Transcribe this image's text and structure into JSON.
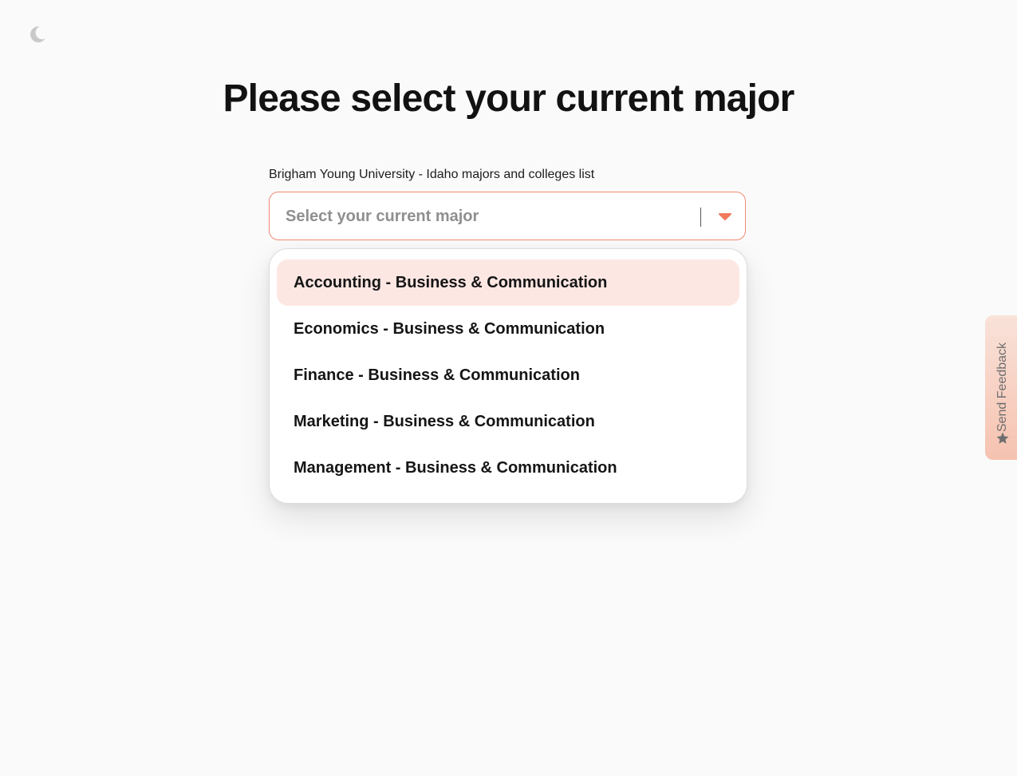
{
  "header": {
    "theme_toggle_icon": "moon-icon",
    "title": "Please select your current major"
  },
  "form": {
    "label": "Brigham Young University - Idaho majors and colleges list",
    "select": {
      "placeholder": "Select your current major",
      "caret_icon": "caret-down-icon",
      "accent_color": "#ef8a73"
    },
    "options": [
      {
        "label": "Accounting - Business & Communication",
        "highlighted": true
      },
      {
        "label": "Economics - Business & Communication",
        "highlighted": false
      },
      {
        "label": "Finance - Business & Communication",
        "highlighted": false
      },
      {
        "label": "Marketing - Business & Communication",
        "highlighted": false
      },
      {
        "label": "Management - Business & Communication",
        "highlighted": false
      }
    ],
    "highlight_color": "#fde7e3"
  },
  "feedback": {
    "label": "Send Feedback",
    "icon": "star-icon"
  }
}
